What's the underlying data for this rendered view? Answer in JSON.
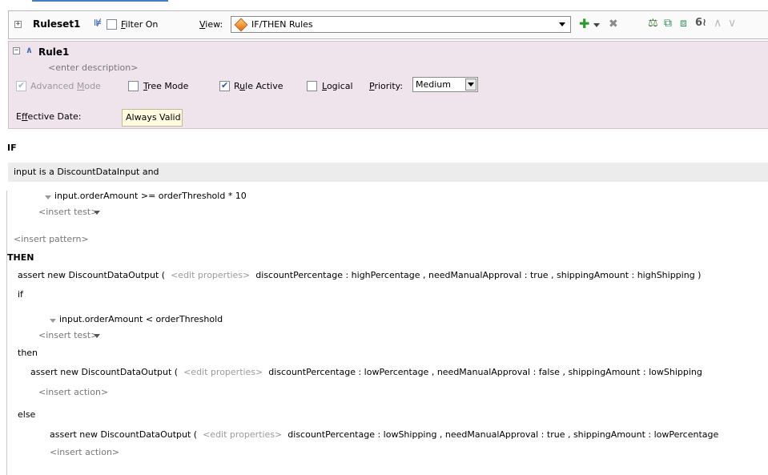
{
  "toolbar": {
    "ruleset_name": "Ruleset1",
    "filter_prefix": "",
    "filter_mnemonic": "F",
    "filter_rest": "ilter On",
    "filter_checked": false,
    "view_mnemonic": "V",
    "view_rest": "iew:",
    "view_value": "IF/THEN Rules",
    "icons": [
      "add-icon",
      "delete-icon",
      "tree-icon",
      "copy-icon",
      "paste-icon",
      "glasses-icon",
      "move-up-icon",
      "move-down-icon"
    ]
  },
  "rule": {
    "name": "Rule1",
    "description_placeholder": "<enter description>",
    "advanced_prefix": "Advanced ",
    "advanced_mnemonic": "M",
    "advanced_rest": "ode",
    "advanced_checked": true,
    "tree_mnemonic": "T",
    "tree_rest": "ree Mode",
    "tree_checked": false,
    "active_prefix": "R",
    "active_mnemonic": "u",
    "active_rest": "le Active",
    "active_checked": true,
    "logical_mnemonic": "L",
    "logical_rest": "ogical",
    "logical_checked": false,
    "priority_mnemonic": "P",
    "priority_rest": "riority:",
    "priority_value": "Medium",
    "effective_prefix": "E",
    "effective_mnemonic": "f",
    "effective_rest": "fective Date:",
    "effective_value": "Always Valid"
  },
  "if_section": {
    "keyword": "IF",
    "pattern": "input is a DiscountDataInput  and",
    "test": "input.orderAmount  >=  orderThreshold * 10",
    "insert_test": "<insert test>",
    "insert_pattern": "<insert pattern>"
  },
  "then_section": {
    "keyword": "THEN",
    "assert_prefix": "assert new DiscountDataOutput (",
    "edit_properties": "<edit properties>",
    "assert_props": "discountPercentage : highPercentage , needManualApproval : true , shippingAmount : highShipping  )",
    "if_keyword": "if",
    "if_test": "input.orderAmount  <  orderThreshold",
    "insert_test": "<insert test>",
    "then_keyword": "then",
    "then_assert_prefix": "assert new DiscountDataOutput (",
    "then_edit_properties": "<edit properties>",
    "then_assert_props": "discountPercentage : lowPercentage , needManualApproval : false , shippingAmount : lowShipping",
    "then_insert_action": "<insert action>",
    "else_keyword": "else",
    "else_assert_prefix": "assert new DiscountDataOutput (",
    "else_edit_properties": "<edit properties>",
    "else_assert_props": "discountPercentage : lowShipping , needManualApproval : true , shippingAmount : lowPercentage",
    "else_insert_action": "<insert action>"
  }
}
